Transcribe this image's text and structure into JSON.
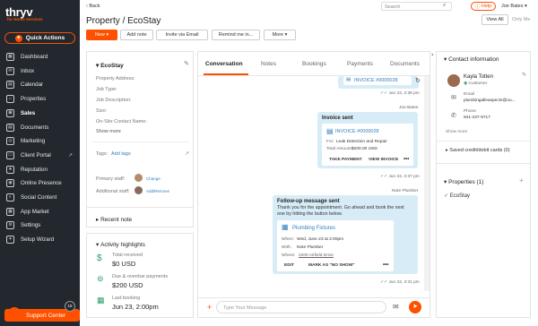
{
  "app": {
    "logo": "thryv",
    "logo_sub": "for Home Services"
  },
  "quick_actions": "Quick Actions",
  "nav": [
    {
      "label": "Dashboard",
      "icon": "dashboard-icon"
    },
    {
      "label": "Inbox",
      "icon": "inbox-icon"
    },
    {
      "label": "Calendar",
      "icon": "calendar-icon"
    },
    {
      "label": "Properties",
      "icon": "properties-icon"
    },
    {
      "label": "Sales",
      "icon": "sales-icon"
    },
    {
      "label": "Documents",
      "icon": "documents-icon"
    },
    {
      "label": "Marketing",
      "icon": "marketing-icon"
    },
    {
      "label": "Client Portal",
      "icon": "client-portal-icon"
    },
    {
      "label": "Reputation",
      "icon": "reputation-icon"
    },
    {
      "label": "Online Presence",
      "icon": "online-presence-icon"
    },
    {
      "label": "Social Content",
      "icon": "social-content-icon"
    },
    {
      "label": "App Market",
      "icon": "app-market-icon"
    },
    {
      "label": "Settings",
      "icon": "settings-icon"
    },
    {
      "label": "Setup Wizard",
      "icon": "setup-wizard-icon"
    }
  ],
  "support": {
    "label": "Support Center",
    "badge": "15"
  },
  "topbar": {
    "back": "Back",
    "search_placeholder": "Search",
    "help": "Help",
    "user": "Joe Bates"
  },
  "page": {
    "title": "Property / EcoStay"
  },
  "actions": {
    "new": "New",
    "add_note": "Add note",
    "invite": "Invite via Email",
    "remind": "Remind me in...",
    "more": "More"
  },
  "view": {
    "all": "View All",
    "me": "Only Me"
  },
  "property": {
    "name": "EcoStay",
    "fields": [
      "Property Address:",
      "Job Type:",
      "Job Description:",
      "Size:",
      "On-Site Contact Name:"
    ],
    "show_more": "Show more",
    "tags_label": "Tags:",
    "add_tags": "Add tags",
    "primary_staff_label": "Primary staff:",
    "primary_staff": "Change",
    "additional_staff_label": "Additional staff:",
    "additional_staff": "Add/Remove"
  },
  "recent_note": "Recent note",
  "activity": {
    "title": "Activity highlights",
    "items": [
      {
        "label": "Total received",
        "value": "$0 USD"
      },
      {
        "label": "Due & overdue payments",
        "value": "$200 USD"
      },
      {
        "label": "Last booking",
        "value": "Jun 23, 2:00pm"
      }
    ]
  },
  "tabs": [
    "Conversation",
    "Notes",
    "Bookings",
    "Payments",
    "Documents"
  ],
  "conversation": {
    "msg1": {
      "invoice": "INVOICE #0000028",
      "time": "Jun 23, 2:36 pm"
    },
    "sender1": "Joe Bates",
    "msg2": {
      "title": "Invoice sent",
      "invoice": "INVOICE #0000028",
      "for_label": "For:",
      "for_value": "Leak Detection and Repair",
      "total_label": "Total Amount:",
      "total_value": "$200.00 USD",
      "take_payment": "TAKE PAYMENT",
      "view_invoice": "VIEW INVOICE",
      "time": "Jun 23, 2:37 pm"
    },
    "sender2": "Note Plumber",
    "msg3": {
      "title": "Follow-up message sent",
      "body": "Thank you for the appointment. Go ahead and book the next one by hitting the button below.",
      "service": "Plumbing Fixtures",
      "when_label": "When:",
      "when_value": "Wed, June 23 at 2:00pm",
      "with_label": "With:",
      "with_value": "Note Plumber",
      "where_label": "Where:",
      "where_value": "2200 Airfield Drive",
      "edit": "EDIT",
      "mark": "MARK AS \"NO SHOW\"",
      "time": "Jun 23, 3:31 pm"
    },
    "input_placeholder": "Type Your Message"
  },
  "contact": {
    "title": "Contact information",
    "name": "Kayla Totten",
    "role": "Customer",
    "email_label": "Email",
    "email": "plumbingalleaspects@ou...",
    "phone_label": "Phone",
    "phone": "941-237-9717",
    "show_more": "Show more",
    "saved_cards": "Saved credit/debit cards (0)"
  },
  "properties": {
    "title": "Properties (1)",
    "items": [
      "EcoStay"
    ]
  },
  "colors": {
    "brand": "#ff5000",
    "sidebar": "#23282e",
    "bubble": "#d7ecf7",
    "link": "#2f7fc0"
  }
}
